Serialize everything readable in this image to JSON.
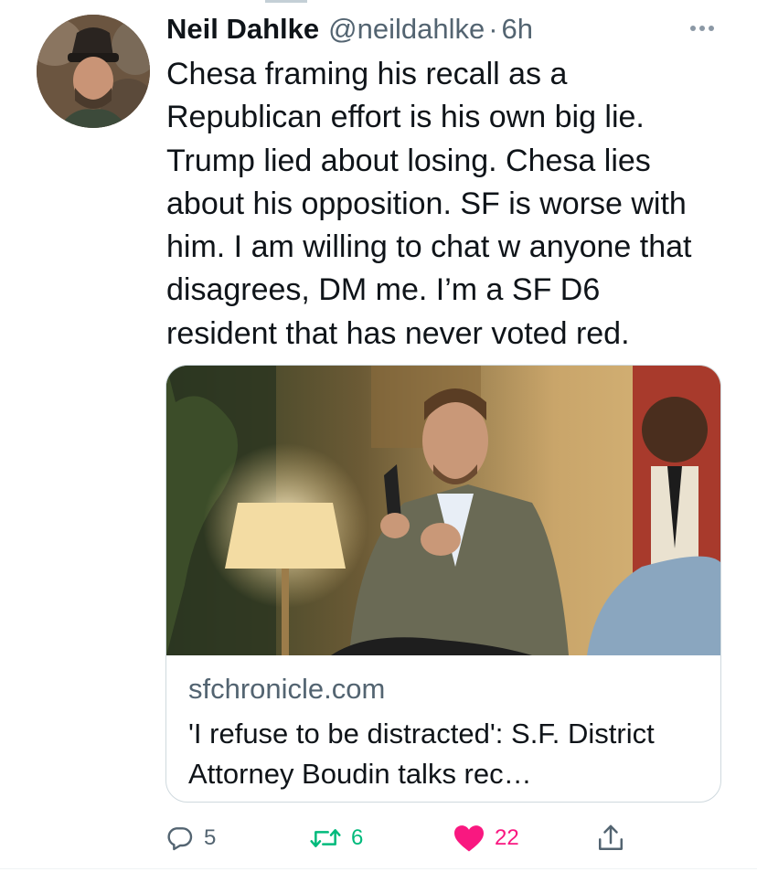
{
  "tweet": {
    "author_name": "Neil Dahlke",
    "author_handle": "@neildahlke",
    "separator": "·",
    "timestamp": "6h",
    "text": "Chesa framing his recall as a\nRepublican effort is his own big lie.\nTrump lied about losing. Chesa lies\nabout his opposition. SF is worse with\nhim. I am willing to chat w anyone that\ndisagrees, DM me. I’m a SF D6\nresident that has never voted red."
  },
  "card": {
    "domain": "sfchronicle.com",
    "title": "'I refuse to be distracted': S.F. District Attorney Boudin talks rec…"
  },
  "actions": {
    "reply_count": "5",
    "retweet_count": "6",
    "like_count": "22",
    "like_active": true
  },
  "colors": {
    "text": "#0f1419",
    "secondary": "#536471",
    "retweet": "#00ba7c",
    "like": "#f91880",
    "border": "#cfd9de"
  },
  "icons": [
    "more-icon",
    "reply-icon",
    "retweet-icon",
    "heart-filled-icon",
    "share-icon"
  ]
}
